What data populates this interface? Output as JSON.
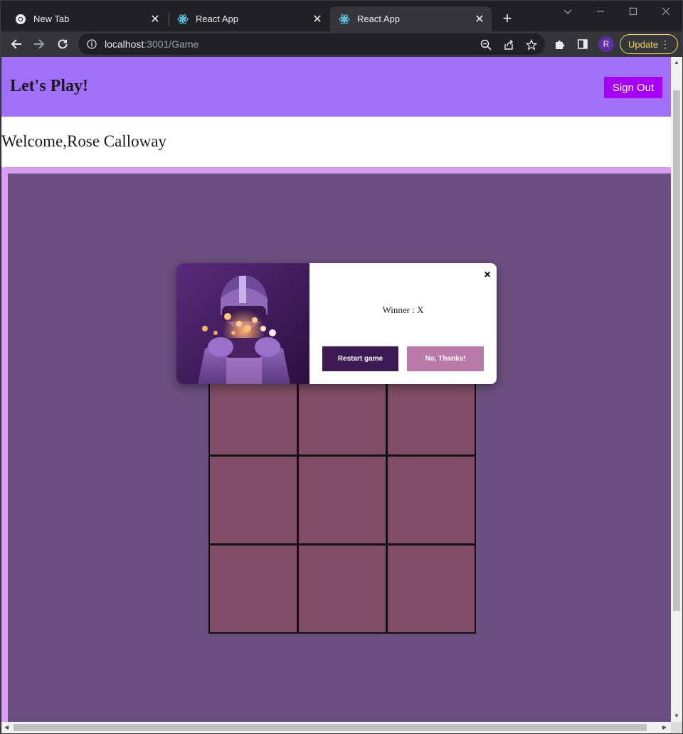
{
  "tabs": [
    {
      "title": "New Tab",
      "icon": "chrome-icon",
      "active": false
    },
    {
      "title": "React App",
      "icon": "react-icon",
      "active": false
    },
    {
      "title": "React App",
      "icon": "react-icon",
      "active": true
    }
  ],
  "address_bar": {
    "host": "localhost",
    "path": ":3001/Game"
  },
  "profile_initial": "R",
  "update_label": "Update",
  "app": {
    "title": "Let's Play!",
    "sign_out_label": "Sign Out",
    "welcome_text": "Welcome,Rose Calloway"
  },
  "board": {
    "cells": [
      "",
      "",
      "",
      "",
      "",
      "",
      "",
      "",
      ""
    ]
  },
  "modal": {
    "message": "Winner : X",
    "restart_label": "Restart game",
    "decline_label": "No, Thanks!",
    "close_glyph": "×"
  },
  "colors": {
    "header_bg": "#a070f8",
    "sign_out_bg": "#a600f5",
    "game_bg": "#6b4f80",
    "cell_bg": "#7f4e66",
    "restart_bg": "#3e1a54",
    "decline_bg": "#b97aaa"
  }
}
